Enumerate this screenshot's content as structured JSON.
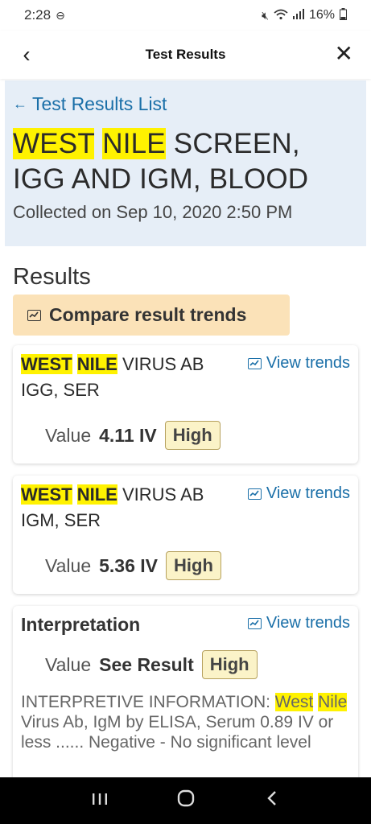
{
  "status": {
    "time": "2:28",
    "battery": "16%"
  },
  "appbar": {
    "title": "Test Results"
  },
  "hero": {
    "breadcrumb": "Test Results List",
    "title_line1_hl1": "WEST",
    "title_line1_hl2": "NILE",
    "title_line1_rest": "SCREEN,",
    "title_line2": "IGG AND IGM, BLOOD",
    "collected": "Collected on Sep 10, 2020 2:50 PM"
  },
  "results": {
    "heading": "Results",
    "compare_label": "Compare result trends",
    "items": [
      {
        "hl1": "WEST",
        "hl2": "NILE",
        "rest": "VIRUS AB",
        "line2": "IGG, SER",
        "trends": "View trends",
        "value_label": "Value",
        "value": "4.11 IV",
        "flag": "High"
      },
      {
        "hl1": "WEST",
        "hl2": "NILE",
        "rest": "VIRUS AB",
        "line2": "IGM, SER",
        "trends": "View trends",
        "value_label": "Value",
        "value": "5.36 IV",
        "flag": "High"
      }
    ],
    "interpretation": {
      "title": "Interpretation",
      "trends": "View trends",
      "value_label": "Value",
      "value": "See Result",
      "flag": "High",
      "text_pre": "INTERPRETIVE INFORMATION: ",
      "text_hl1": "West",
      "text_hl2": "Nile",
      "text_rest": " Virus Ab, IgM by ELISA, Serum 0.89 IV or less ...... Negative - No significant level"
    }
  },
  "colors": {
    "link": "#1a6fa8",
    "highlight": "#fff200",
    "compare_bg": "#fbe2b8",
    "hero_bg": "#e6eef7"
  }
}
